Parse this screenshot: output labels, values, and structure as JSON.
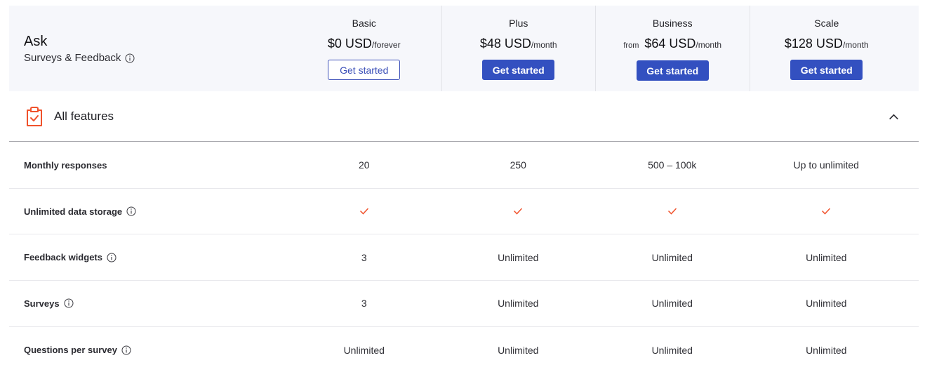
{
  "product": {
    "name": "Ask",
    "subtitle": "Surveys & Feedback",
    "subtitle_icon": "info-icon"
  },
  "plans": [
    {
      "name": "Basic",
      "price_prefix": "",
      "price": "$0 USD",
      "period": "/forever",
      "button_label": "Get started",
      "button_style": "outline"
    },
    {
      "name": "Plus",
      "price_prefix": "",
      "price": "$48 USD",
      "period": "/month",
      "button_label": "Get started",
      "button_style": "solid"
    },
    {
      "name": "Business",
      "price_prefix": "from",
      "price": "$64 USD",
      "period": "/month",
      "button_label": "Get started",
      "button_style": "solid"
    },
    {
      "name": "Scale",
      "price_prefix": "",
      "price": "$128 USD",
      "period": "/month",
      "button_label": "Get started",
      "button_style": "solid"
    }
  ],
  "features_section": {
    "title": "All features",
    "icon": "clipboard-check-icon",
    "toggle_icon": "chevron-up-icon",
    "expanded": true
  },
  "features": [
    {
      "label": "Monthly responses",
      "has_info": false,
      "values": [
        "20",
        "250",
        "500 – 100k",
        "Up to unlimited"
      ]
    },
    {
      "label": "Unlimited data storage",
      "has_info": true,
      "values": [
        "check",
        "check",
        "check",
        "check"
      ]
    },
    {
      "label": "Feedback widgets",
      "has_info": true,
      "values": [
        "3",
        "Unlimited",
        "Unlimited",
        "Unlimited"
      ]
    },
    {
      "label": "Surveys",
      "has_info": true,
      "values": [
        "3",
        "Unlimited",
        "Unlimited",
        "Unlimited"
      ]
    },
    {
      "label": "Questions per survey",
      "has_info": true,
      "values": [
        "Unlimited",
        "Unlimited",
        "Unlimited",
        "Unlimited"
      ]
    }
  ],
  "colors": {
    "accent_blue": "#3350c0",
    "accent_orange": "#f0522c",
    "header_bg": "#f6f7fb"
  }
}
